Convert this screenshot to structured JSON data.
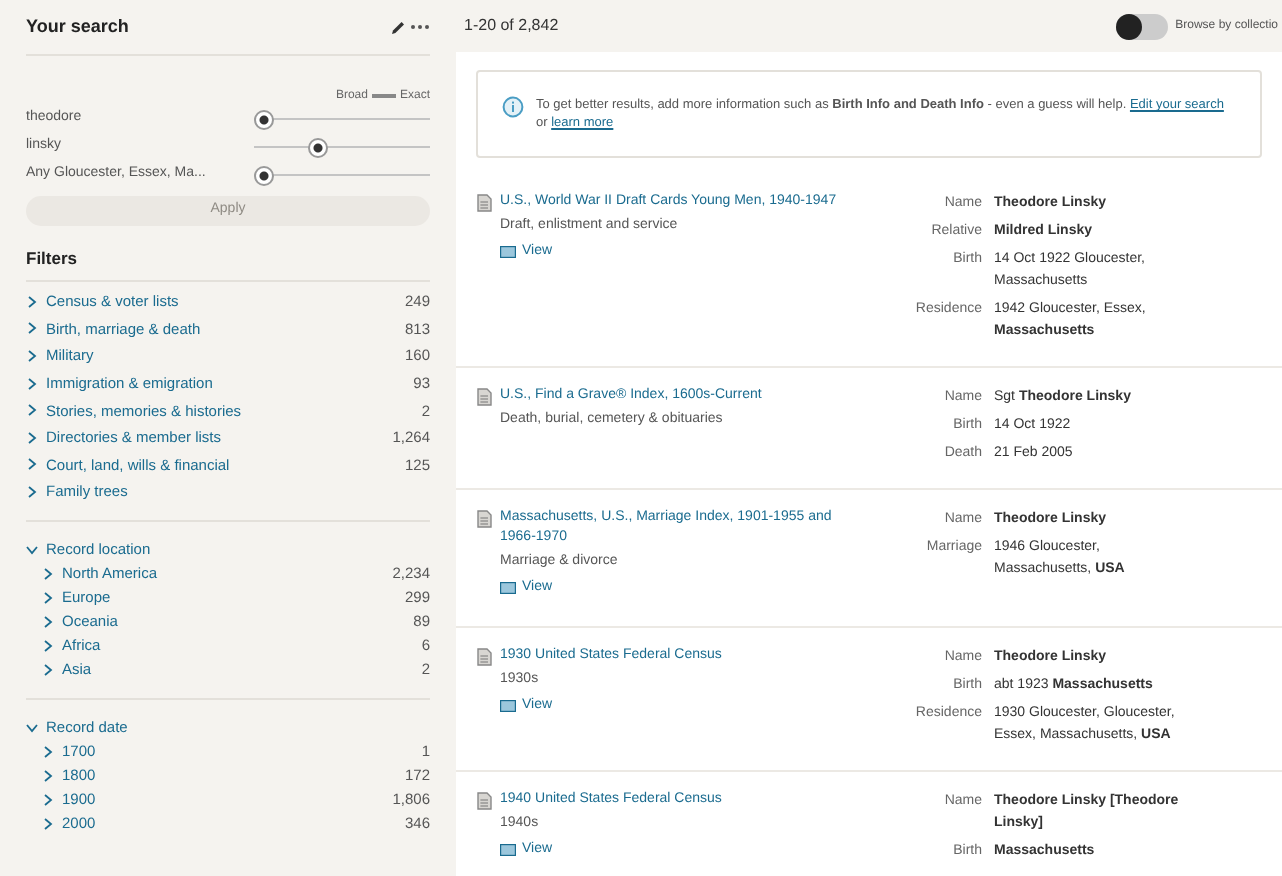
{
  "search": {
    "title": "Your search",
    "scale_left": "Broad",
    "scale_right": "Exact",
    "terms": [
      {
        "label": "theodore",
        "level": 0
      },
      {
        "label": "linsky",
        "level": 0.35
      },
      {
        "label": "Any Gloucester, Essex, Ma...",
        "level": 0
      }
    ],
    "apply": {
      "label": "Apply",
      "disabled": true
    }
  },
  "filters": {
    "title": "Filters",
    "groups": [
      {
        "items": [
          {
            "label": "Census & voter lists",
            "count": "249",
            "expanded": false
          },
          {
            "label": "Birth, marriage & death",
            "count": "813",
            "expanded": false
          },
          {
            "label": "Military",
            "count": "160",
            "expanded": false
          },
          {
            "label": "Immigration & emigration",
            "count": "93",
            "expanded": false
          },
          {
            "label": "Stories, memories & histories",
            "count": "2",
            "expanded": false
          },
          {
            "label": "Directories & member lists",
            "count": "1,264",
            "expanded": false
          },
          {
            "label": "Court, land, wills & financial",
            "count": "125",
            "expanded": false
          },
          {
            "label": "Family trees",
            "expanded": false
          }
        ]
      },
      {
        "items": [
          {
            "label": "Record location",
            "expanded": true,
            "children": [
              {
                "label": "North America",
                "count": "2,234",
                "expanded": false
              },
              {
                "label": "Europe",
                "count": "299",
                "expanded": false
              },
              {
                "label": "Oceania",
                "count": "89",
                "expanded": false
              },
              {
                "label": "Africa",
                "count": "6",
                "expanded": false
              },
              {
                "label": "Asia",
                "count": "2",
                "expanded": false
              }
            ]
          }
        ]
      },
      {
        "items": [
          {
            "label": "Record date",
            "expanded": true,
            "children": [
              {
                "label": "1700",
                "count": "1",
                "expanded": false
              },
              {
                "label": "1800",
                "count": "172",
                "expanded": false
              },
              {
                "label": "1900",
                "count": "1,806",
                "expanded": false
              },
              {
                "label": "2000",
                "count": "346",
                "expanded": false
              }
            ]
          }
        ]
      }
    ]
  },
  "results_bar": {
    "count": "1-20 of 2,842",
    "toggle": {
      "label": "Browse by collectio",
      "on": false
    }
  },
  "info": {
    "text": "To get better results, add more information such as **Birth Info and Death Info** - even a guess will help.",
    "link_1": "Edit your search",
    "middle": "or",
    "link_2": "learn more"
  },
  "records": [
    {
      "title": "U.S., World War II Draft Cards Young Men, 1940-1947",
      "category": "Draft, enlistment and service",
      "view": "View",
      "fields": [
        {
          "label": "Name",
          "value": "Theodore Linsky",
          "bold": true
        },
        {
          "label": "Relative",
          "value": "Mildred Linsky",
          "bold": true
        },
        {
          "label": "Birth",
          "value": "14 Oct 1922 Gloucester, Massachusetts",
          "bold": false
        },
        {
          "label": "Residence",
          "value": "1942 Gloucester, Essex, **Massachusetts**",
          "bold": false
        }
      ]
    },
    {
      "title": "U.S., Find a Grave® Index, 1600s-Current",
      "category": "Death, burial, cemetery & obituaries",
      "fields": [
        {
          "label": "Name",
          "value": "Sgt **Theodore Linsky**",
          "bold": false
        },
        {
          "label": "Birth",
          "value": "14 Oct 1922",
          "bold": false
        },
        {
          "label": "Death",
          "value": "21 Feb 2005",
          "bold": false
        }
      ]
    },
    {
      "title": "Massachusetts, U.S., Marriage Index, 1901-1955 and 1966-1970",
      "category": "Marriage & divorce",
      "view": "View",
      "fields": [
        {
          "label": "Name",
          "value": "Theodore Linsky",
          "bold": true
        },
        {
          "label": "Marriage",
          "value": "1946 Gloucester, Massachusetts, **USA**",
          "bold": false
        }
      ]
    },
    {
      "title": "1930 United States Federal Census",
      "category": "1930s",
      "view": "View",
      "fields": [
        {
          "label": "Name",
          "value": "Theodore Linsky",
          "bold": true
        },
        {
          "label": "Birth",
          "value": "abt 1923 **Massachusetts**",
          "bold": false
        },
        {
          "label": "Residence",
          "value": "1930 Gloucester, Gloucester, Essex, Massachusetts, **USA**",
          "bold": false
        }
      ]
    },
    {
      "title": "1940 United States Federal Census",
      "category": "1940s",
      "view": "View",
      "fields": [
        {
          "label": "Name",
          "value": "Theodore Linsky [Theodore Linsky]",
          "bold": true
        },
        {
          "label": "Birth",
          "value": "Massachusetts",
          "bold": true
        }
      ]
    }
  ]
}
